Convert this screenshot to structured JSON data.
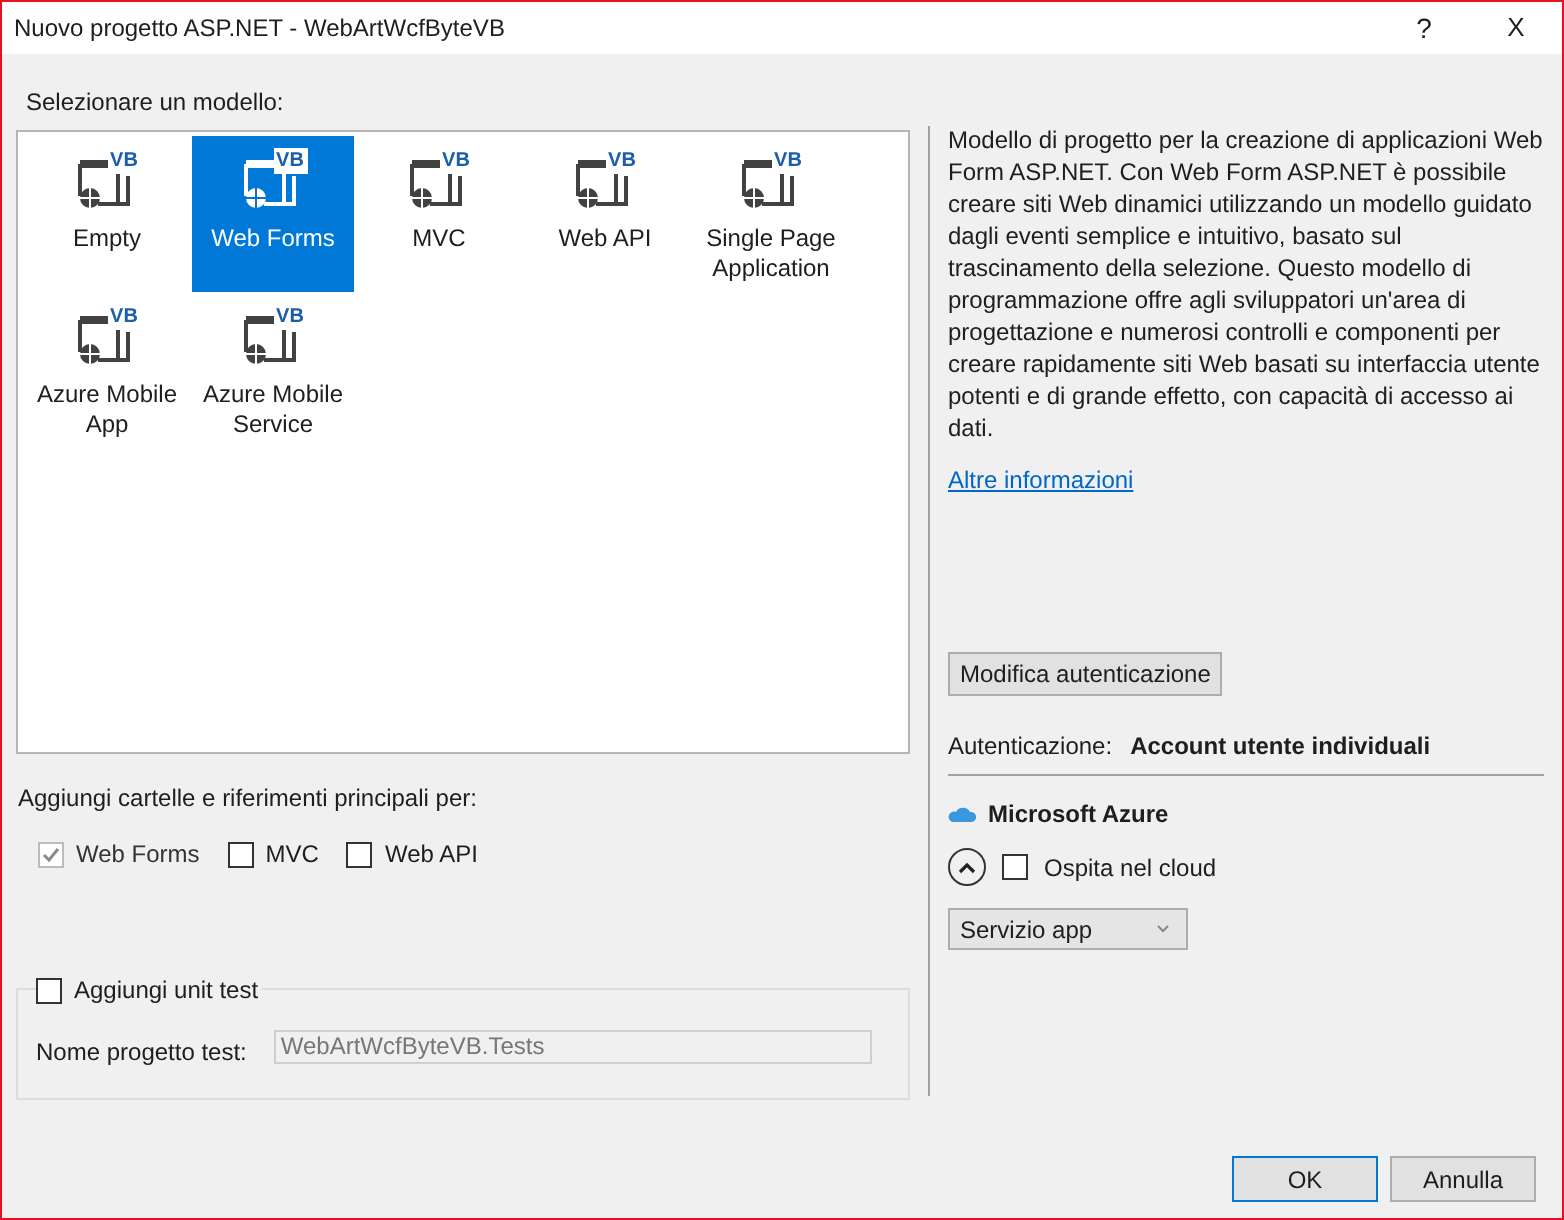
{
  "window": {
    "title": "Nuovo progetto ASP.NET - WebArtWcfByteVB",
    "help": "?",
    "close": "X"
  },
  "templates_label": "Selezionare un modello:",
  "templates": [
    {
      "label": "Empty",
      "badge": "VB",
      "selected": false
    },
    {
      "label": "Web Forms",
      "badge": "VB",
      "selected": true
    },
    {
      "label": "MVC",
      "badge": "VB",
      "selected": false
    },
    {
      "label": "Web API",
      "badge": "VB",
      "selected": false
    },
    {
      "label": "Single Page Application",
      "badge": "VB",
      "selected": false
    },
    {
      "label": "Azure Mobile App",
      "badge": "VB",
      "selected": false
    },
    {
      "label": "Azure Mobile Service",
      "badge": "VB",
      "selected": false
    }
  ],
  "folders_label": "Aggiungi cartelle e riferimenti principali per:",
  "folders": [
    {
      "label": "Web Forms",
      "checked": true,
      "disabled": true
    },
    {
      "label": "MVC",
      "checked": false,
      "disabled": false
    },
    {
      "label": "Web API",
      "checked": false,
      "disabled": false
    }
  ],
  "unit_test": {
    "label": "Aggiungi unit test",
    "checked": false,
    "name_label": "Nome progetto test:",
    "name_value": "WebArtWcfByteVB.Tests"
  },
  "description": "Modello di progetto per la creazione di applicazioni Web Form ASP.NET. Con Web Form ASP.NET è possibile creare siti Web dinamici utilizzando un modello guidato dagli eventi semplice e intuitivo, basato sul trascinamento della selezione. Questo modello di programmazione offre agli sviluppatori un'area di progettazione e numerosi controlli e componenti per creare rapidamente siti Web basati su interfaccia utente potenti e di grande effetto, con capacità di accesso ai dati.",
  "more_link": "Altre informazioni",
  "auth_button": "Modifica autenticazione",
  "auth_label": "Autenticazione:",
  "auth_value": "Account utente individuali",
  "azure": {
    "title": "Microsoft Azure",
    "host_label": "Ospita nel cloud",
    "host_checked": false,
    "service": "Servizio app"
  },
  "buttons": [
    "OK",
    "Annulla"
  ]
}
